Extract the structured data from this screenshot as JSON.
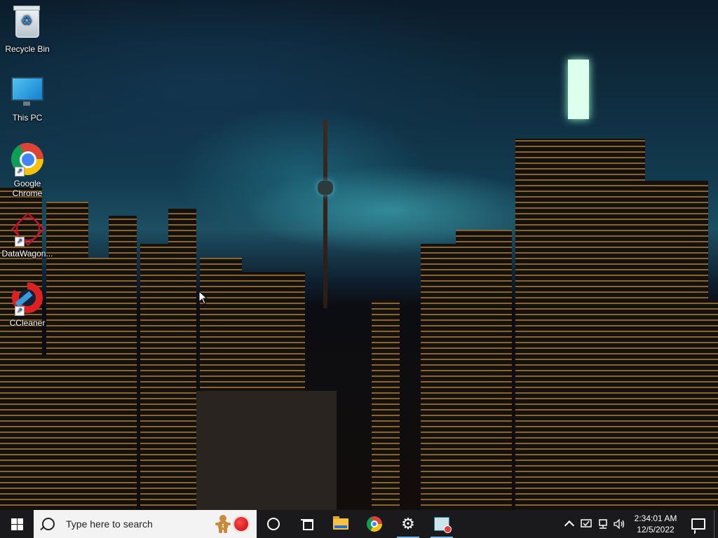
{
  "desktop": {
    "icons": [
      {
        "label": "Recycle Bin",
        "icon": "recycle-bin-icon"
      },
      {
        "label": "This PC",
        "icon": "computer-monitor-icon"
      },
      {
        "label": "Google Chrome",
        "icon": "chrome-icon",
        "shortcut": true
      },
      {
        "label": "DataWagon...",
        "icon": "datawagon-icon",
        "shortcut": true
      },
      {
        "label": "CCleaner",
        "icon": "ccleaner-icon",
        "shortcut": true
      }
    ]
  },
  "taskbar": {
    "search_placeholder": "Type here to search",
    "pinned": [
      "start",
      "search",
      "cortana",
      "task-view",
      "file-explorer",
      "chrome",
      "settings",
      "app-window"
    ],
    "tray": {
      "time": "2:34:01 AM",
      "date": "12/5/2022"
    }
  },
  "colors": {
    "taskbar": "#1a1a1c",
    "search_box": "#f3f3f3",
    "active_indicator": "#7cb8ea"
  }
}
